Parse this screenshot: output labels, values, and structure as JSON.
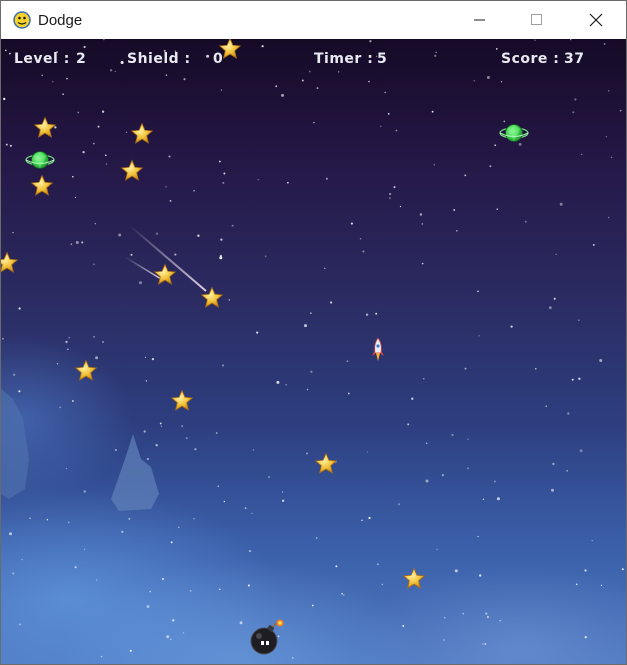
{
  "window": {
    "title": "Dodge",
    "minimize_icon": "minimize-icon",
    "maximize_icon": "maximize-icon",
    "close_icon": "close-icon"
  },
  "hud": {
    "level_label": "Level :",
    "level_value": "2",
    "shield_label": "Shield :",
    "shield_value": "0",
    "timer_label": "Timer :",
    "timer_value": "5",
    "score_label": "Score :",
    "score_value": "37"
  },
  "sprites": {
    "star_icon": "gold-star-icon",
    "gem_icon": "green-gem-icon",
    "rocket_icon": "rocket-icon",
    "bomb_icon": "bomb-icon"
  },
  "colors": {
    "star": "#f2c23a",
    "gem": "#3fd14f",
    "hud_text": "#e9e9f2"
  }
}
